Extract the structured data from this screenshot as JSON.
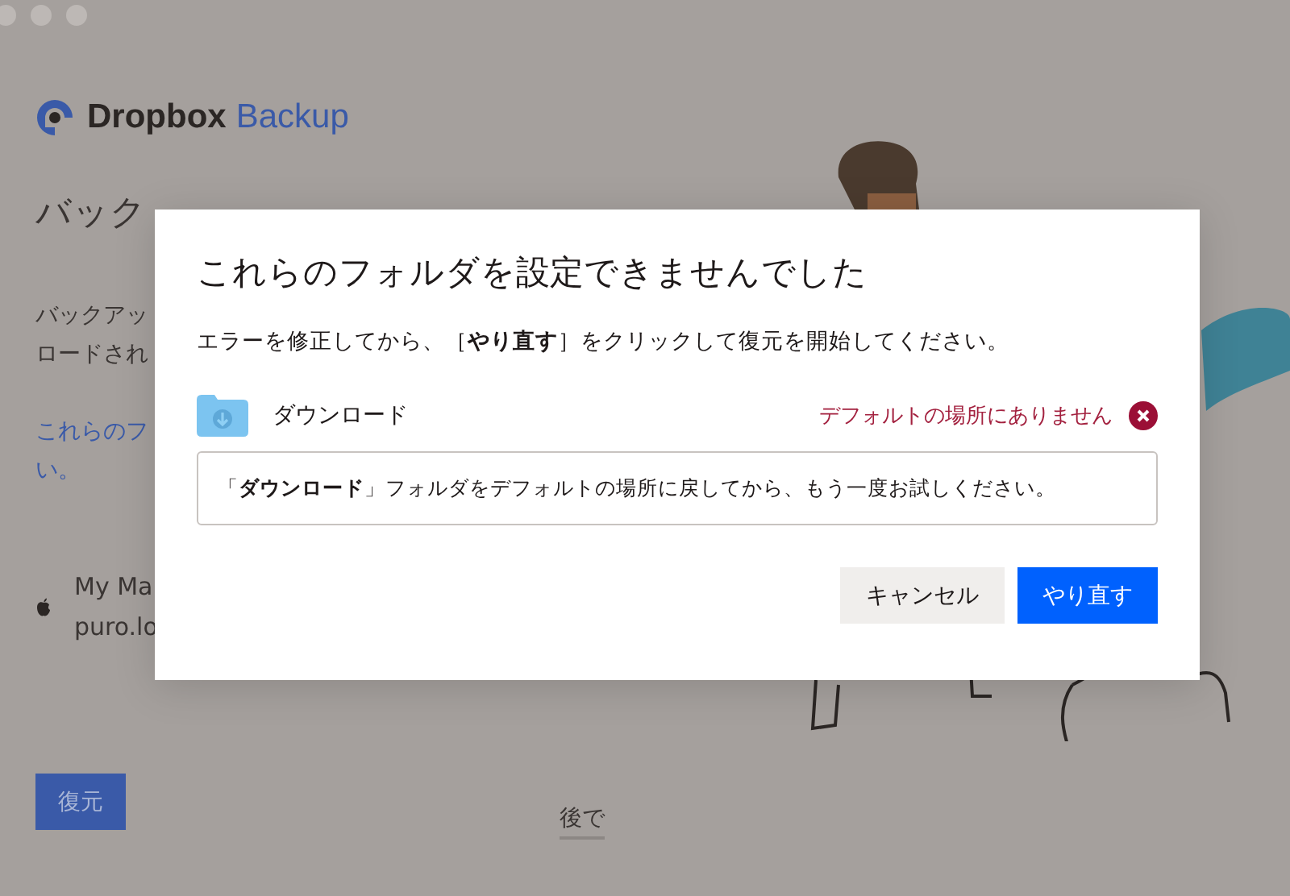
{
  "app": {
    "logo_word": "Dropbox",
    "logo_product": "Backup",
    "heading": "バック",
    "description_lines": [
      "バックアッ",
      "ロードされ"
    ],
    "link_lines": [
      "これらのフ",
      "い。"
    ],
    "device": {
      "name": "My Ma",
      "host": "puro.lo"
    },
    "restore_button": "復元",
    "later_link": "後で"
  },
  "dialog": {
    "title": "これらのフォルダを設定できませんでした",
    "message": "エラーを修正してから、［**やり直す**］をクリックして復元を開始してください。",
    "folders": [
      {
        "name": "ダウンロード",
        "status": "デフォルトの場所にありません",
        "error": true,
        "hint": "「**ダウンロード**」フォルダをデフォルトの場所に戻してから、もう一度お試しください。"
      }
    ],
    "buttons": [
      {
        "label": "キャンセル",
        "kind": "secondary"
      },
      {
        "label": "やり直す",
        "kind": "primary"
      }
    ]
  }
}
